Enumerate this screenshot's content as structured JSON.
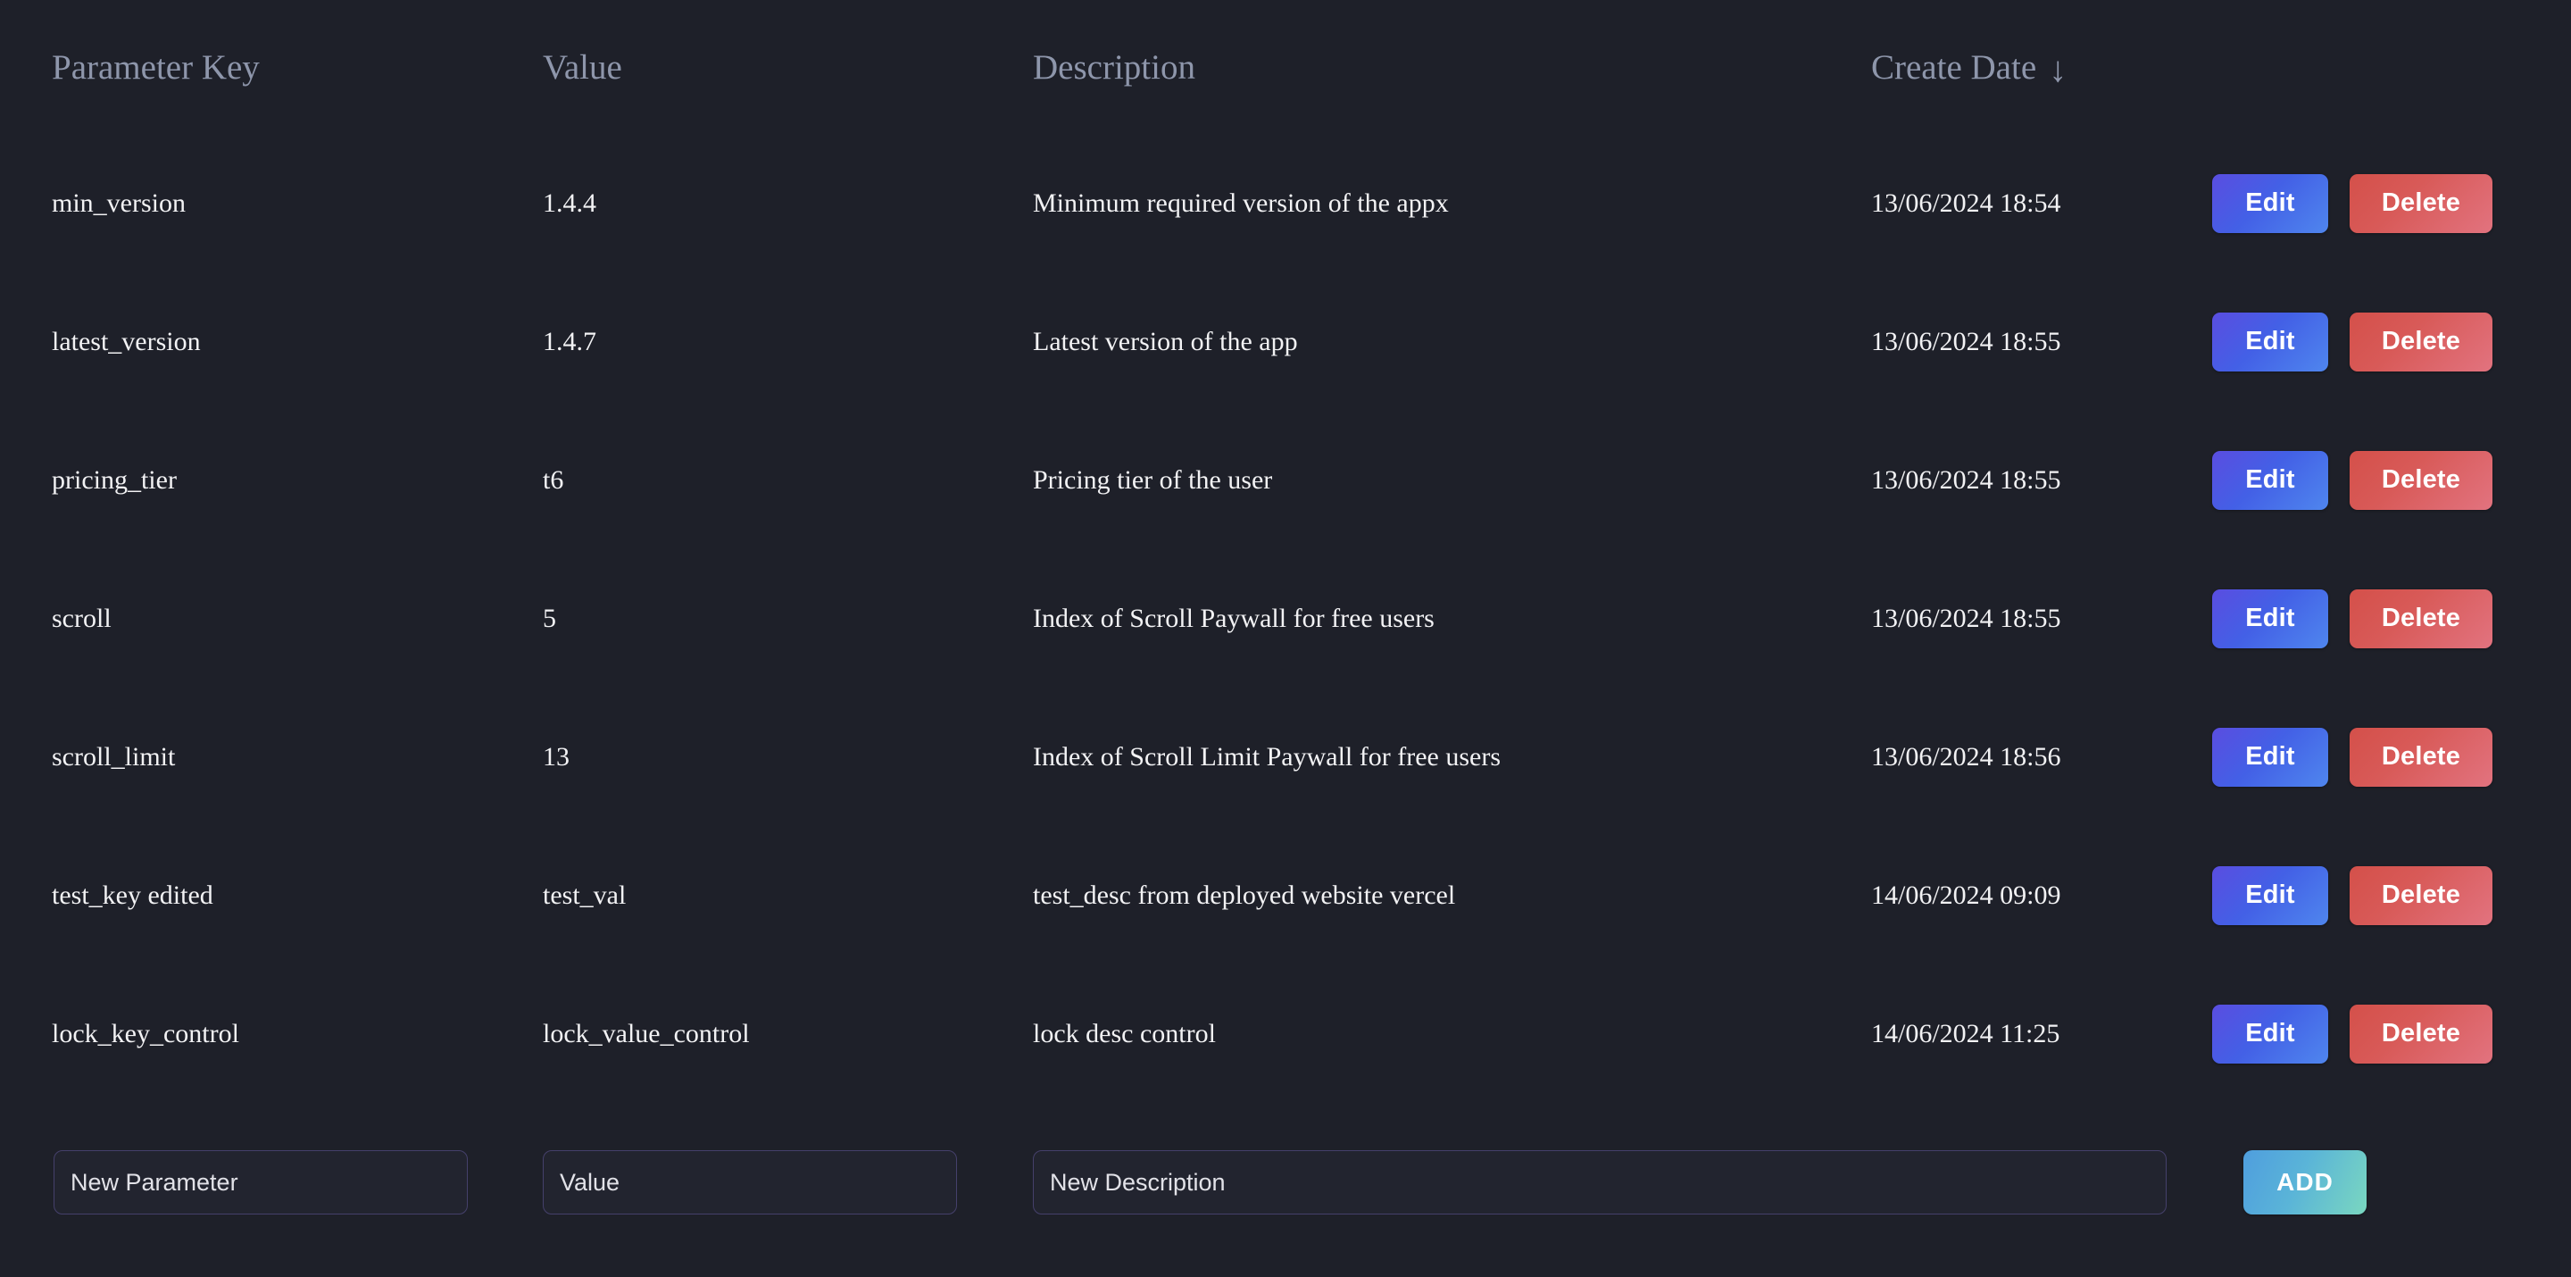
{
  "theme": {
    "background": "#1e2029",
    "header_text": "#8e96ab",
    "body_text": "#f2f2f4",
    "edit_button": "#4360e6",
    "delete_button": "#d85a58",
    "add_button": "#5ab4d8",
    "field_border": "#45406b"
  },
  "table": {
    "columns": [
      {
        "key": "parameter_key",
        "label": "Parameter Key",
        "sorted": false
      },
      {
        "key": "value",
        "label": "Value",
        "sorted": false
      },
      {
        "key": "description",
        "label": "Description",
        "sorted": false
      },
      {
        "key": "create_date",
        "label": "Create Date",
        "sorted": true,
        "sort_direction": "desc",
        "sort_icon": "arrow-down-icon",
        "sort_glyph": "↓"
      }
    ],
    "row_actions": {
      "edit_label": "Edit",
      "delete_label": "Delete"
    },
    "rows": [
      {
        "parameter_key": "min_version",
        "value": "1.4.4",
        "description": "Minimum required version of the appx",
        "create_date": "13/06/2024 18:54"
      },
      {
        "parameter_key": "latest_version",
        "value": "1.4.7",
        "description": "Latest version of the app",
        "create_date": "13/06/2024 18:55"
      },
      {
        "parameter_key": "pricing_tier",
        "value": "t6",
        "description": "Pricing tier of the user",
        "create_date": "13/06/2024 18:55"
      },
      {
        "parameter_key": "scroll",
        "value": "5",
        "description": "Index of Scroll Paywall for free users",
        "create_date": "13/06/2024 18:55"
      },
      {
        "parameter_key": "scroll_limit",
        "value": "13",
        "description": "Index of Scroll Limit Paywall for free users",
        "create_date": "13/06/2024 18:56"
      },
      {
        "parameter_key": "test_key edited",
        "value": "test_val",
        "description": "test_desc from deployed website vercel",
        "create_date": "14/06/2024 09:09"
      },
      {
        "parameter_key": "lock_key_control",
        "value": "lock_value_control",
        "description": "lock desc control",
        "create_date": "14/06/2024 11:25"
      }
    ]
  },
  "new_row_form": {
    "parameter_input": {
      "value": "",
      "placeholder": "New Parameter"
    },
    "value_input": {
      "value": "",
      "placeholder": "Value"
    },
    "description_input": {
      "value": "",
      "placeholder": "New Description"
    },
    "add_button_label": "ADD"
  }
}
